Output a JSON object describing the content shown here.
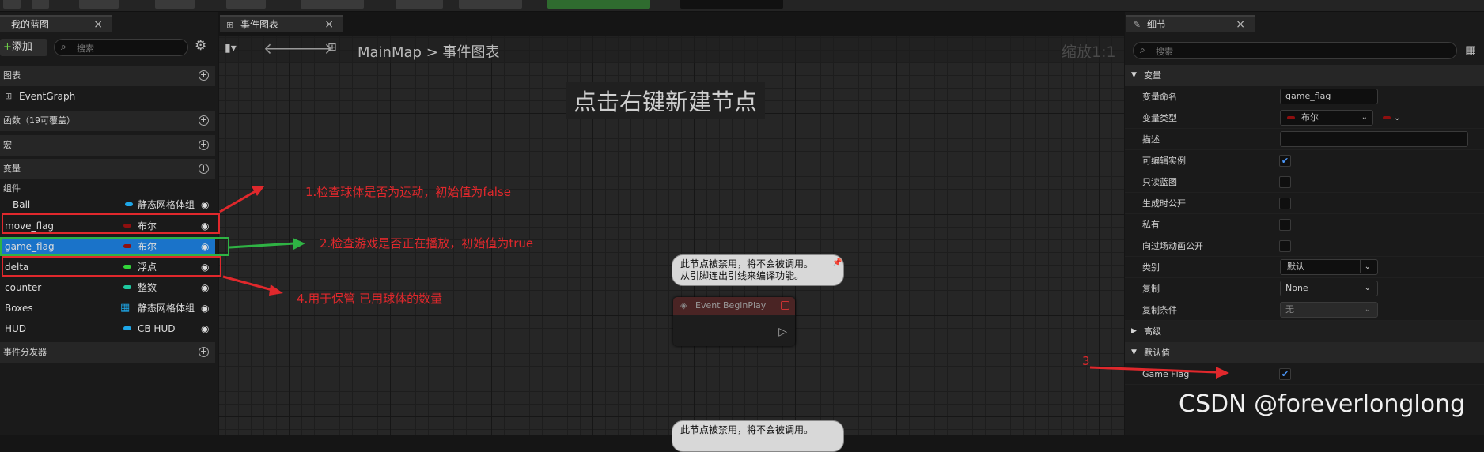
{
  "toolbar": {
    "play_color": "#2f6b2f"
  },
  "left_panel": {
    "tab_label": "我的蓝图",
    "tab_close": "×",
    "add_label": "+添加",
    "search_placeholder": "搜索",
    "sections": {
      "graphs": "图表",
      "event_graph": "EventGraph",
      "functions": "函数（19可覆盖）",
      "macros": "宏",
      "variables": "变量",
      "components": "组件",
      "dispatchers": "事件分发器"
    },
    "variables": [
      {
        "name": "Ball",
        "type": "静态网格体组",
        "color": "#1ea7e8"
      },
      {
        "name": "move_flag",
        "type": "布尔",
        "color": "#8e0f0f"
      },
      {
        "name": "game_flag",
        "type": "布尔",
        "color": "#8e0f0f"
      },
      {
        "name": "delta",
        "type": "浮点",
        "color": "#32d43a"
      },
      {
        "name": "counter",
        "type": "整数",
        "color": "#1ec9a0"
      },
      {
        "name": "Boxes",
        "type": "静态网格体组",
        "color": "#1ea7e8"
      },
      {
        "name": "HUD",
        "type": "CB HUD",
        "color": "#1ea7e8"
      }
    ]
  },
  "graph": {
    "tab_label": "事件图表",
    "tab_close": "×",
    "breadcrumb_root": "MainMap",
    "breadcrumb_sep": ">",
    "breadcrumb_current": "事件图表",
    "zoom": "缩放1:1",
    "hint": "点击右键新建节点",
    "comment_1": "此节点被禁用，将不会被调用。\n从引脚连出引线来编译功能。",
    "comment_2": "此节点被禁用，将不会被调用。",
    "node_title": "Event BeginPlay"
  },
  "details": {
    "tab_label": "细节",
    "tab_close": "×",
    "search_placeholder": "搜索",
    "cat_variable": "变量",
    "rows": {
      "name_label": "变量命名",
      "name_value": "game_flag",
      "type_label": "变量类型",
      "type_value": "布尔",
      "desc_label": "描述",
      "editable_label": "可编辑实例",
      "readonly_label": "只读蓝图",
      "expose_label": "生成时公开",
      "private_label": "私有",
      "cinematic_label": "向过场动画公开",
      "category_label": "类别",
      "category_value": "默认",
      "replication_label": "复制",
      "replication_value": "None",
      "repcond_label": "复制条件",
      "repcond_value": "无"
    },
    "cat_advanced": "高级",
    "cat_default": "默认值",
    "default_label": "Game Flag"
  },
  "annotations": {
    "a1": "1.检查球体是否为运动，初始值为false",
    "a2": "2.检查游戏是否正在播放，初始值为true",
    "a3": "3",
    "a4": "4.用于保管 已用球体的数量"
  },
  "watermark": "CSDN @foreverlonglong"
}
